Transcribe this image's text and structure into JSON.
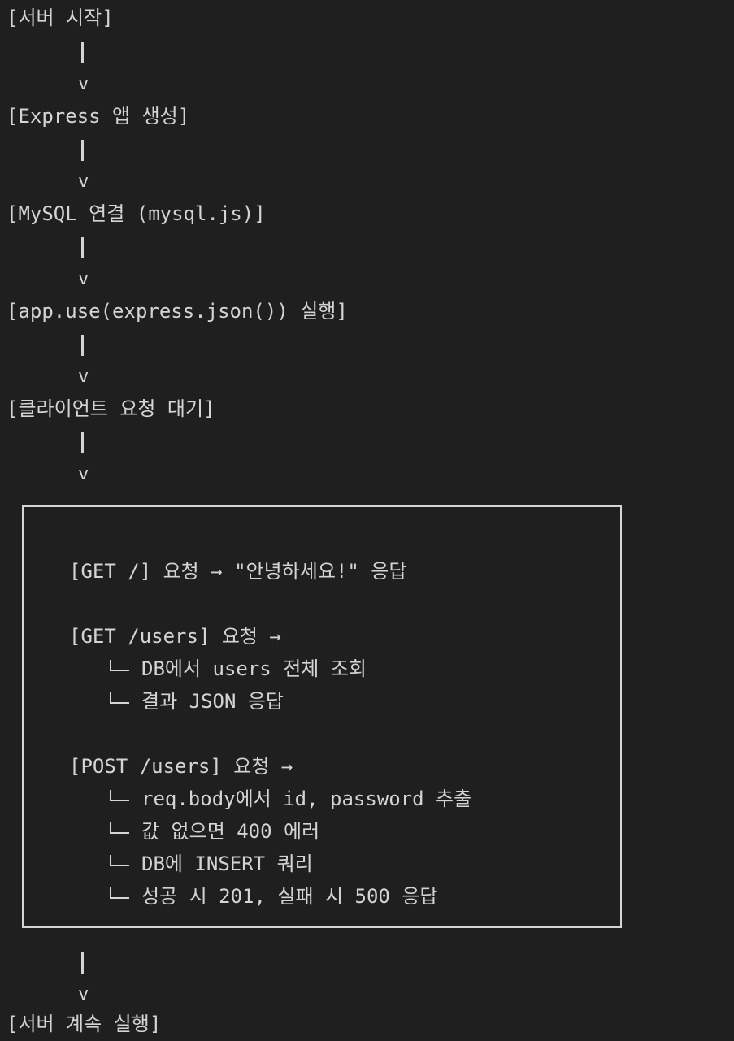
{
  "steps": {
    "server_start": "[서버 시작]",
    "express_app": "[Express 앱 생성]",
    "mysql_connect": "[MySQL 연결 (mysql.js)]",
    "app_use_json": "[app.use(express.json()) 실행]",
    "wait_request": "[클라이언트 요청 대기]",
    "server_continue": "[서버 계속 실행]"
  },
  "flow_arrow": "v",
  "routes": {
    "get_root": {
      "heading": "[GET /] 요청 → \"안녕하세요!\" 응답"
    },
    "get_users": {
      "heading": "[GET /users] 요청 →",
      "details": [
        "DB에서 users 전체 조회",
        "결과 JSON 응답"
      ]
    },
    "post_users": {
      "heading": "[POST /users] 요청 →",
      "details": [
        "req.body에서 id, password 추출",
        "값 없으면 400 에러",
        "DB에 INSERT 쿼리",
        "성공 시 201, 실패 시 500 응답"
      ]
    }
  }
}
